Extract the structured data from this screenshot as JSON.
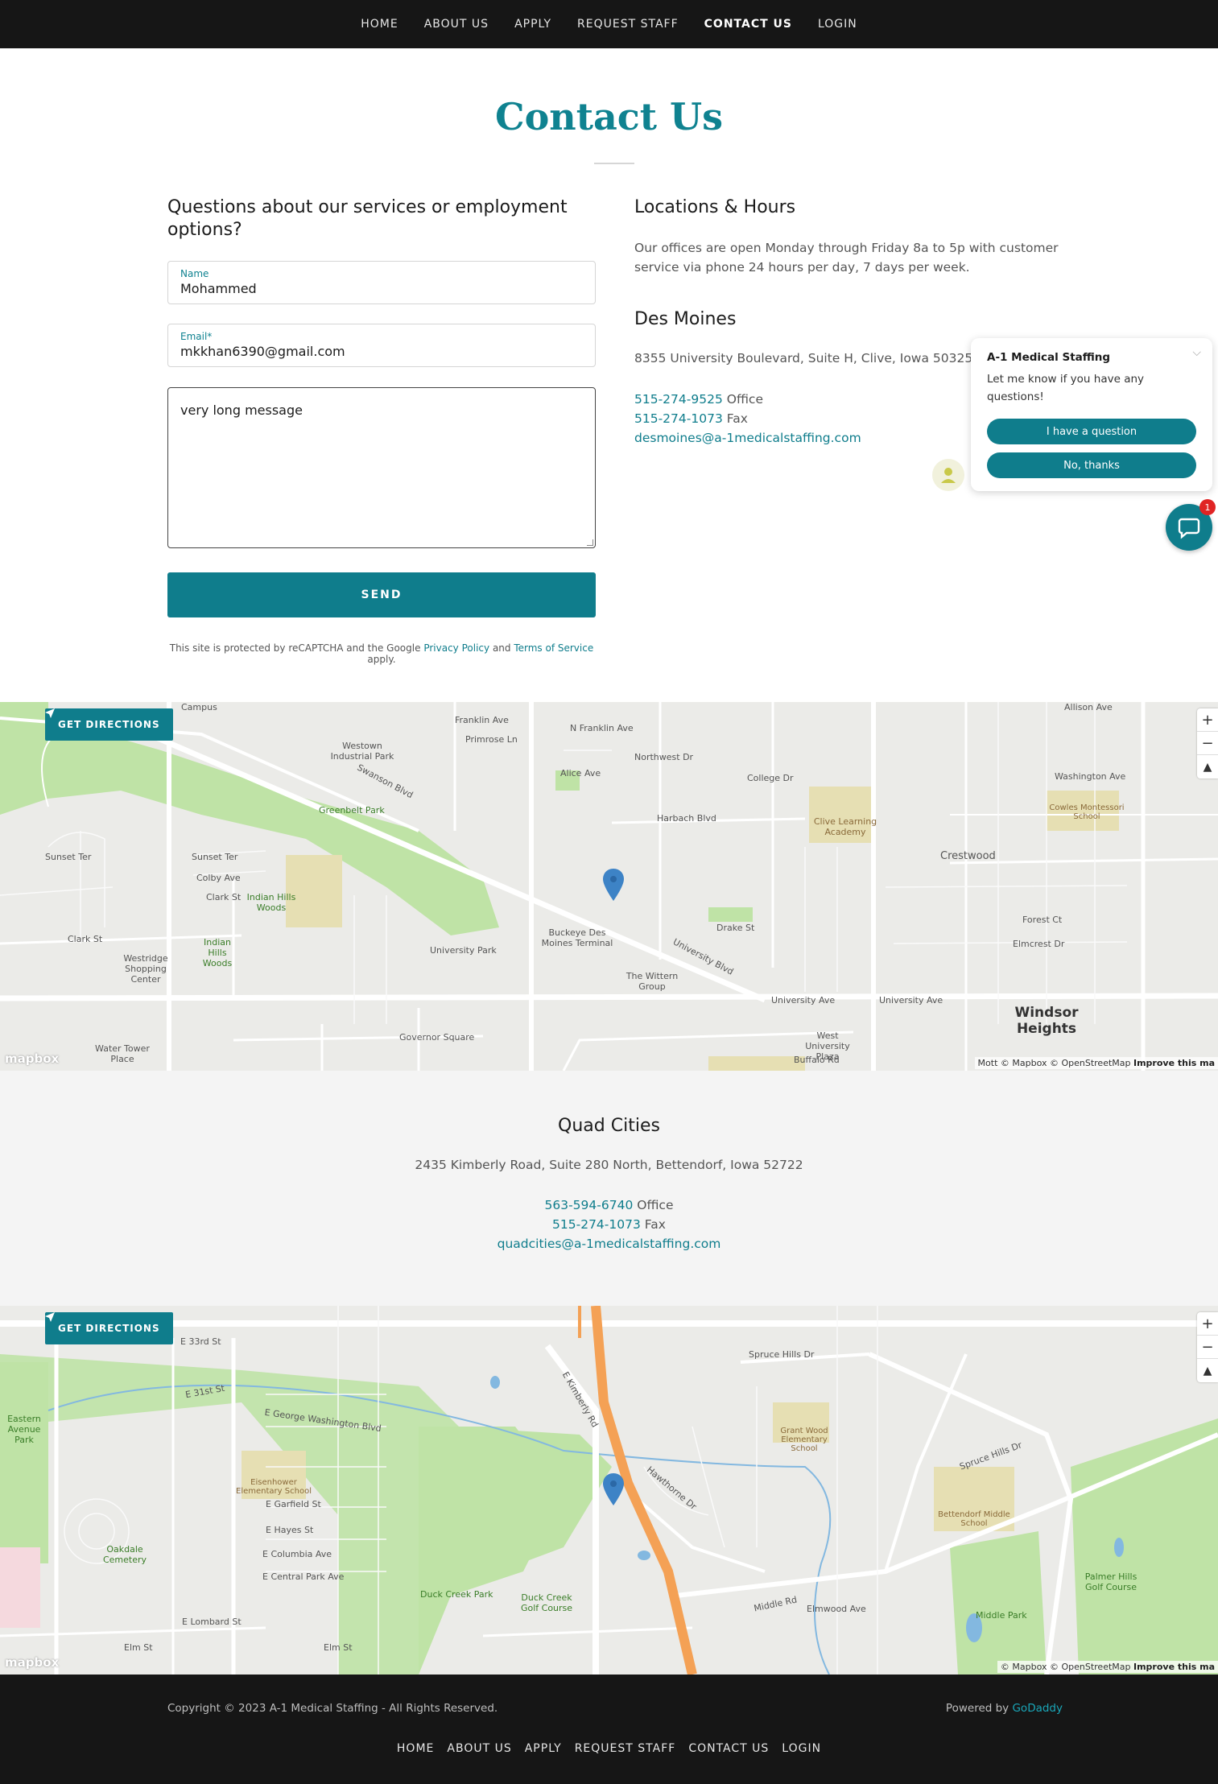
{
  "nav": {
    "items": [
      "HOME",
      "ABOUT US",
      "APPLY",
      "REQUEST STAFF",
      "CONTACT US",
      "LOGIN"
    ],
    "active": "CONTACT US"
  },
  "page": {
    "title": "Contact Us"
  },
  "form": {
    "heading": "Questions about our services or employment options?",
    "name_label": "Name",
    "name_value": "Mohammed",
    "email_label": "Email*",
    "email_value": "mkkhan6390@gmail.com",
    "message_value": "very long message",
    "send_label": "SEND",
    "recaptcha_prefix": "This site is protected by reCAPTCHA and the Google",
    "privacy_link": "Privacy Policy",
    "and_text": "and",
    "terms_link": "Terms of Service",
    "apply_text": "apply."
  },
  "locations": {
    "heading": "Locations & Hours",
    "hours_text": "Our offices are open Monday through Friday 8a to 5p with customer service via phone 24 hours per day, 7 days per week.",
    "des_moines": {
      "name": "Des Moines",
      "address": "8355 University Boulevard, Suite H, Clive, Iowa 50325",
      "office_phone": "515-274-9525",
      "office_label": "Office",
      "fax_phone": "515-274-1073",
      "fax_label": "Fax",
      "email": "desmoines@a-1medicalstaffing.com"
    },
    "quad_cities": {
      "name": "Quad Cities",
      "address": "2435 Kimberly Road, Suite 280 North, Bettendorf, Iowa 52722",
      "office_phone": "563-594-6740",
      "office_label": "Office",
      "fax_phone": "515-274-1073",
      "fax_label": "Fax",
      "email": "quadcities@a-1medicalstaffing.com"
    }
  },
  "chat": {
    "title": "A-1 Medical Staffing",
    "message": "Let me know if you have any questions!",
    "question_button": "I have a question",
    "no_button": "No, thanks",
    "badge_count": "1"
  },
  "map": {
    "directions_label": "GET DIRECTIONS",
    "zoom_in": "+",
    "zoom_out": "−",
    "compass": "▲",
    "logo": "mapbox",
    "attribution_1": "Mott © Mapbox © OpenStreetMap",
    "attribution_2": "© Mapbox © OpenStreetMap",
    "improve": "Improve this ma",
    "labels_1": [
      "Franklin Ave",
      "Primrose Ln",
      "N Franklin Ave",
      "Northwest Dr",
      "College Dr",
      "Alice Ave",
      "Harbach Blvd",
      "Clive Learning Academy",
      "Westown Industrial Park",
      "Swanson Blvd",
      "Greenbelt Park",
      "Sunset Ter",
      "Colby Ave",
      "Clark St",
      "Indian Hills Woods",
      "Crestwood",
      "Drake St",
      "University Blvd",
      "Buckeye Des Moines Terminal",
      "The Wittern Group",
      "University Park",
      "Westridge Shopping Center",
      "University Ave",
      "Windsor Heights",
      "Water Tower Place",
      "Governor Square",
      "West University Plaza",
      "Buffalo Rd",
      "Cowles Montessori School",
      "Washington Ave",
      "Allison Ave",
      "Forest Ct",
      "Elmcrest Dr",
      "Campus"
    ],
    "labels_2": [
      "Spruce Hills Dr",
      "E Kimberly Rd",
      "Grant Wood Elementary School",
      "Eisenhower Elementary School",
      "E George Washington Blvd",
      "Oakdale Cemetery",
      "Duck Creek Park",
      "Duck Creek Golf Course",
      "Bettendorf Middle School",
      "Middle Park",
      "Palmer Hills Golf Course",
      "Middle Rd",
      "Elmwood Ave",
      "E 33rd St",
      "E 31st St",
      "E Garfield St",
      "E Hayes St",
      "E Columbia Ave",
      "E Central Park Ave",
      "E Lombard St",
      "Elm St",
      "Hawthorne Dr",
      "Eastern Avenue Park"
    ]
  },
  "footer": {
    "copyright": "Copyright © 2023 A-1 Medical Staffing - All Rights Reserved.",
    "powered_by": "Powered by",
    "powered_link": "GoDaddy",
    "nav": [
      "HOME",
      "ABOUT US",
      "APPLY",
      "REQUEST STAFF",
      "CONTACT US",
      "LOGIN"
    ]
  }
}
